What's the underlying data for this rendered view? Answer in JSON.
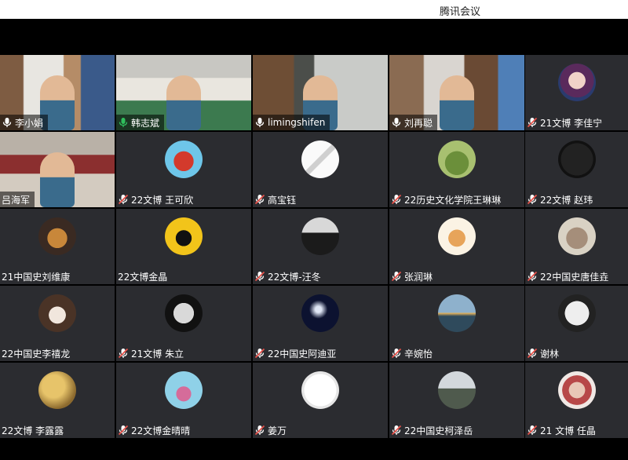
{
  "window": {
    "title": "腾讯会议"
  },
  "colors": {
    "tile_bg": "#2b2c30",
    "active_speaker": "#2fbf5c",
    "muted": "#e8524a"
  },
  "participants": [
    {
      "name": "李小娟",
      "mic": "on",
      "video": true,
      "avatar": "office-video"
    },
    {
      "name": "韩志斌",
      "mic": "active",
      "video": true,
      "avatar": "man-glasses-video"
    },
    {
      "name": "limingshifen",
      "mic": "on",
      "video": true,
      "avatar": "closeup-video"
    },
    {
      "name": "刘再聪",
      "mic": "on",
      "video": true,
      "avatar": "bookshelf-video"
    },
    {
      "name": "21文博 李佳宁",
      "mic": "muted",
      "video": false,
      "avatar": "painted-portrait"
    },
    {
      "name": "吕海军",
      "mic": "none",
      "video": true,
      "avatar": "library-video"
    },
    {
      "name": "22文博 王可欣",
      "mic": "muted",
      "video": false,
      "avatar": "red-cow-cartoon"
    },
    {
      "name": "高宝钰",
      "mic": "muted",
      "video": false,
      "avatar": "sketch-faces"
    },
    {
      "name": "22历史文化学院王琳琳",
      "mic": "muted",
      "video": false,
      "avatar": "green-meadow"
    },
    {
      "name": "22文博 赵玮",
      "mic": "muted",
      "video": false,
      "avatar": "study-logo"
    },
    {
      "name": "21中国史刘维康",
      "mic": "none",
      "video": false,
      "avatar": "cat-cartoon"
    },
    {
      "name": "22文博金晶",
      "mic": "none",
      "video": false,
      "avatar": "black-cat-yellow"
    },
    {
      "name": "22文博-汪冬",
      "mic": "muted",
      "video": false,
      "avatar": "person-beach"
    },
    {
      "name": "张润琳",
      "mic": "muted",
      "video": false,
      "avatar": "cloud-bread"
    },
    {
      "name": "22中国史唐佳垚",
      "mic": "muted",
      "video": false,
      "avatar": "otter"
    },
    {
      "name": "22中国史李禧龙",
      "mic": "none",
      "video": false,
      "avatar": "fluffy-pet"
    },
    {
      "name": "21文博 朱立",
      "mic": "muted",
      "video": false,
      "avatar": "moon"
    },
    {
      "name": "22中国史阿迪亚",
      "mic": "muted",
      "video": false,
      "avatar": "night-light"
    },
    {
      "name": "辛婉怡",
      "mic": "muted",
      "video": false,
      "avatar": "sunset-sea"
    },
    {
      "name": "谢林",
      "mic": "muted",
      "video": false,
      "avatar": "meme-face"
    },
    {
      "name": "22文博 李露露",
      "mic": "none",
      "video": false,
      "avatar": "gold-swirl"
    },
    {
      "name": "22文博金晴晴",
      "mic": "muted",
      "video": false,
      "avatar": "cartoon-tree"
    },
    {
      "name": "姜万",
      "mic": "muted",
      "video": false,
      "avatar": "line-drawing"
    },
    {
      "name": "22中国史柯泽岳",
      "mic": "muted",
      "video": false,
      "avatar": "building-photo"
    },
    {
      "name": "21 文博 任晶",
      "mic": "muted",
      "video": false,
      "avatar": "flower-girl"
    }
  ]
}
